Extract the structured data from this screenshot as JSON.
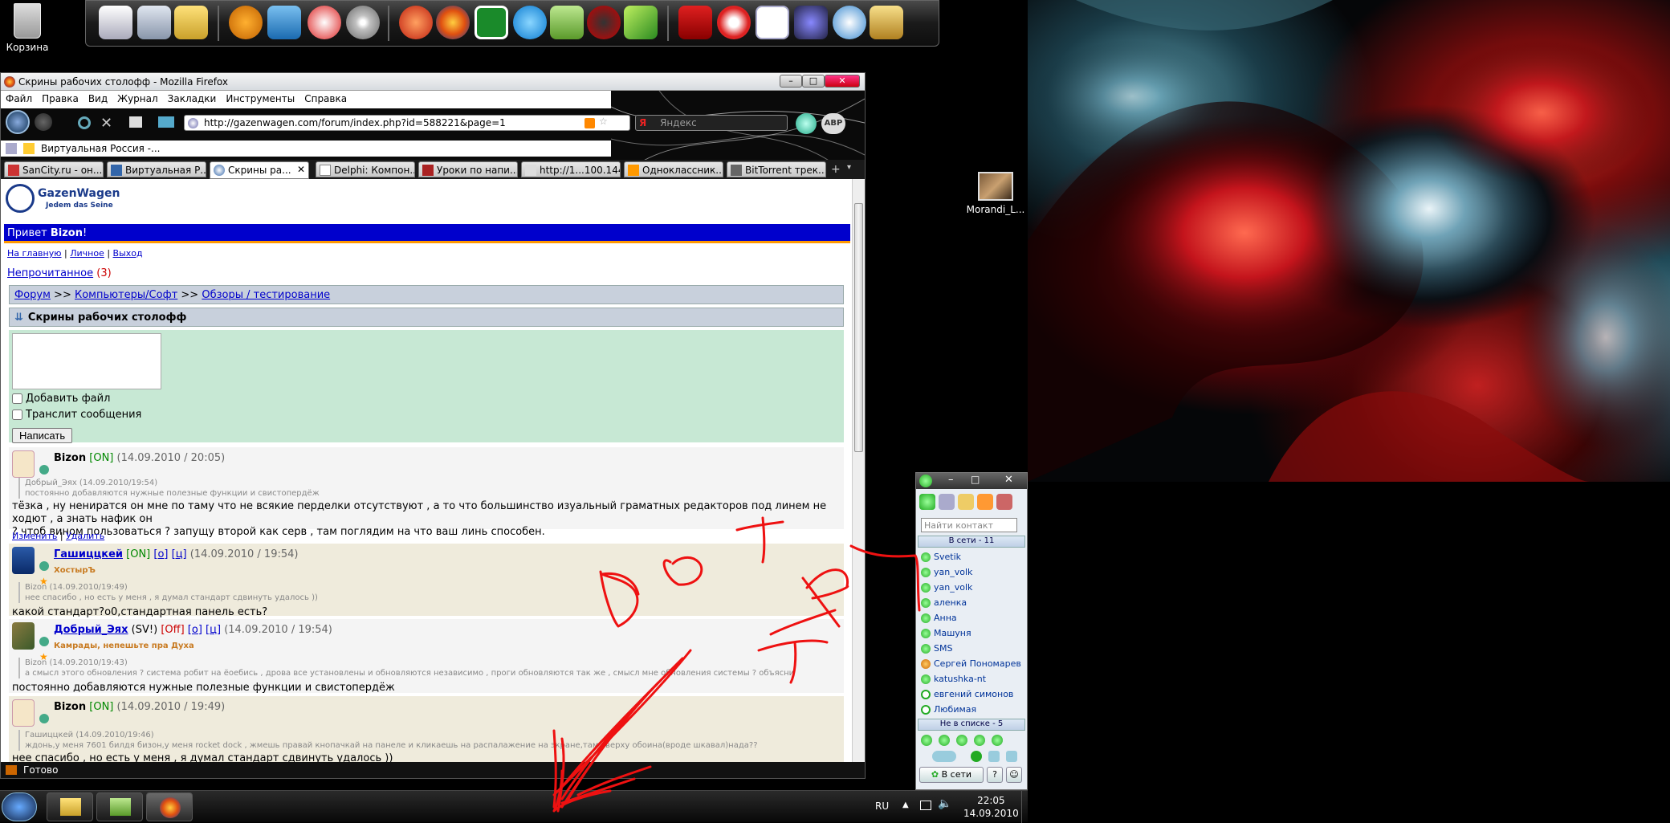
{
  "desktop": {
    "recycle_bin_label": "Корзина",
    "file_icon_label": "Morandi_L..."
  },
  "firefox": {
    "window_title": "Скрины рабочих столофф - Mozilla Firefox",
    "menu": [
      "Файл",
      "Правка",
      "Вид",
      "Журнал",
      "Закладки",
      "Инструменты",
      "Справка"
    ],
    "url": "http://gazenwagen.com/forum/index.php?id=588221&page=1",
    "search_placeholder": "Яндекс",
    "bookmark": "Виртуальная Россия -...",
    "tabs": [
      {
        "label": "SanCity.ru - он...",
        "active": false
      },
      {
        "label": "Виртуальная Р...",
        "active": false
      },
      {
        "label": "Скрины ра...",
        "active": true
      },
      {
        "label": "Delphi: Компон...",
        "active": false
      },
      {
        "label": "Уроки по напи...",
        "active": false
      },
      {
        "label": "http://1...100.144/",
        "active": false
      },
      {
        "label": "Одноклассник...",
        "active": false
      },
      {
        "label": "BitTorrent трек...",
        "active": false
      }
    ],
    "status": "Готово"
  },
  "forum": {
    "logo_title": "GazenWagen",
    "logo_sub": "Jedem das Seine",
    "hello_prefix": "Привет ",
    "hello_user": "Bizon",
    "hello_suffix": "!",
    "links": [
      "На главную",
      "Личное",
      "Выход"
    ],
    "unread_label": "Непрочитанное",
    "unread_count": "(3)",
    "breadcrumb": [
      "Форум",
      "Компьютеры/Софт",
      "Обзоры / тестирование"
    ],
    "breadcrumb_sep": ">>",
    "topic_title": "Скрины рабочих столофф",
    "add_file_label": "Добавить файл",
    "translit_label": "Транслит сообщения",
    "submit_label": "Написать",
    "posts": [
      {
        "author": "Bizon",
        "status": "[ON]",
        "date": "(14.09.2010 / 20:05)",
        "rank": "",
        "quote_head": "Добрый_Эях (14.09.2010/19:54)",
        "quote_body": "постоянно добавляются нужные полезные функции и свистопердёж",
        "body1": "тёзка , ну нениратся он мне по таму что не всякие перделки отсутствуют , а то что большинство изуальный граматных редакторов под линем не ходют , а знать нафик он",
        "body2": "? чтоб вином пользоваться ? запущу второй как серв , там поглядим на что ваш линь способен.",
        "edit": "Изменить",
        "delete": "Удалить"
      },
      {
        "author": "Гашиццкей",
        "status": "[ON]",
        "links": [
          "[о]",
          "[ц]"
        ],
        "date": "(14.09.2010 / 19:54)",
        "rank": "ХостырЪ",
        "quote_head": "Bizon (14.09.2010/19:49)",
        "quote_body": "нее спасибо , но есть у меня , я думал стандарт сдвинуть удалось ))",
        "body1": "какой стандарт?о0,стандартная панель есть?"
      },
      {
        "author": "Добрый_Эях",
        "status_sv": "(SV!)",
        "status": "[Off]",
        "links": [
          "[о]",
          "[ц]"
        ],
        "date": "(14.09.2010 / 19:54)",
        "rank": "Камрады, непешьте пра Духа",
        "quote_head": "Bizon (14.09.2010/19:43)",
        "quote_body": "а смысл этого обновления ? система робит на ёоебись , дрова все установлены и обновляются независимо , проги обновляются так же , смысл мне обновления системы ? объясни",
        "body1": "постоянно добавляются нужные полезные функции и свистопердёж"
      },
      {
        "author": "Bizon",
        "status": "[ON]",
        "date": "(14.09.2010 / 19:49)",
        "rank": "",
        "quote_head": "Гашиццкей (14.09.2010/19:46)",
        "quote_body": "ждонь,у меня 7601 билдя бизон,у меня rocket dock , жмешь правай кнопачкай на панеле и кликаешь на распалажение на экране,там сверху обоина(вроде шкавал)нада??",
        "body1": "нее спасибо , но есть у меня , я думал стандарт сдвинуть удалось ))"
      }
    ]
  },
  "icq": {
    "search_placeholder": "Найти контакт",
    "online_group": "В сети - 11",
    "contacts": [
      "Svetik",
      "yan_volk",
      "yan_volk",
      "аленка",
      "Анна",
      "Машуня",
      "SMS",
      "Сергей Пономарев",
      "katushka-nt",
      "евгений симонов",
      "Любимая"
    ],
    "offline_group": "Не в списке - 5",
    "status_button": "В сети"
  },
  "taskbar": {
    "lang": "RU",
    "time": "22:05",
    "date": "14.09.2010"
  },
  "colors": {
    "forum_blue": "#0000cc",
    "reply_green": "#c7e8d4",
    "scribble_red": "#ee1111"
  }
}
